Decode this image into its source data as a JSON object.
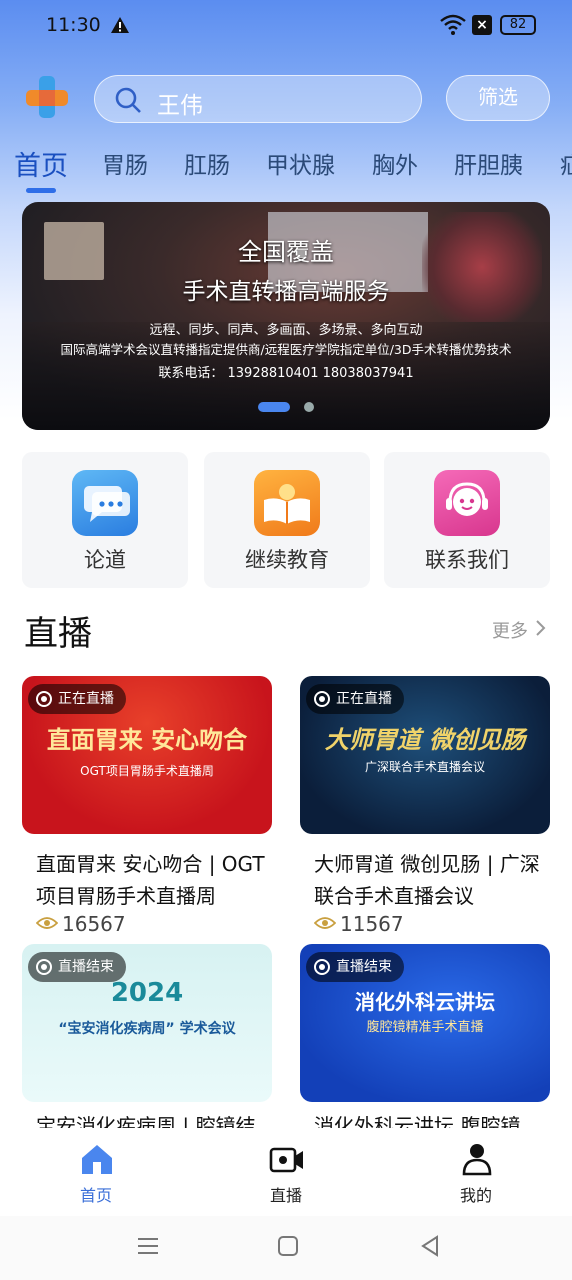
{
  "status": {
    "time": "11:30",
    "battery": "82"
  },
  "search": {
    "query": "王伟",
    "filter_label": "筛选"
  },
  "tabs": [
    "首页",
    "胃肠",
    "肛肠",
    "甲状腺",
    "胸外",
    "肝胆胰",
    "疝"
  ],
  "banner": {
    "title1": "全国覆盖",
    "title2": "手术直转播高端服务",
    "line1": "远程、同步、同声、多画面、多场景、多向互动",
    "line2": "国际高端学术会议直转播指定提供商/远程医疗学院指定单位/3D手术转播优势技术",
    "line3": "联系电话：   13928810401      18038037941",
    "slides": 2,
    "active_slide": 1
  },
  "quick_links": [
    {
      "label": "论道",
      "icon": "chat-bubble-icon"
    },
    {
      "label": "继续教育",
      "icon": "book-icon"
    },
    {
      "label": "联系我们",
      "icon": "headset-robot-icon"
    }
  ],
  "live_section": {
    "title": "直播",
    "more_label": "更多"
  },
  "live_cards": [
    {
      "status": "正在直播",
      "title": "直面胃来 安心吻合 | OGT项目胃肠手术直播周",
      "views": "16567",
      "poster_main": "直面胃来 安心吻合",
      "poster_sub": "OGT项目胃肠手术直播周",
      "colors": {
        "bg1": "#c8141c",
        "bg2": "#e8402a",
        "text": "#ffe79a"
      }
    },
    {
      "status": "正在直播",
      "title": "大师胃道 微创见肠 | 广深联合手术直播会议",
      "views": "11567",
      "poster_main": "大师胃道 微创见肠",
      "poster_sub": "广深联合手术直播会议",
      "colors": {
        "bg1": "#0b1e3a",
        "bg2": "#1e4f7a",
        "text": "#f0d36a"
      }
    },
    {
      "status": "直播结束",
      "title": "宝安消化疾病周 | 腔镜结",
      "poster_main": "2024",
      "poster_sub": "“宝安消化疾病周” 学术会议",
      "colors": {
        "bg1": "#d7f2f2",
        "bg2": "#eafafa",
        "text": "#1a8a9a"
      }
    },
    {
      "status": "直播结束",
      "title": "消化外科云讲坛 腹腔镜",
      "poster_main": "消化外科云讲坛",
      "poster_sub": "腹腔镜精准手术直播",
      "colors": {
        "bg1": "#1340b8",
        "bg2": "#2a6ae8",
        "text": "#ffffff"
      }
    }
  ],
  "bottom_nav": [
    {
      "label": "首页",
      "icon": "home-icon",
      "active": true
    },
    {
      "label": "直播",
      "icon": "video-camera-icon",
      "active": false
    },
    {
      "label": "我的",
      "icon": "user-icon",
      "active": false
    }
  ],
  "theme": {
    "accent": "#3b6fd8"
  }
}
